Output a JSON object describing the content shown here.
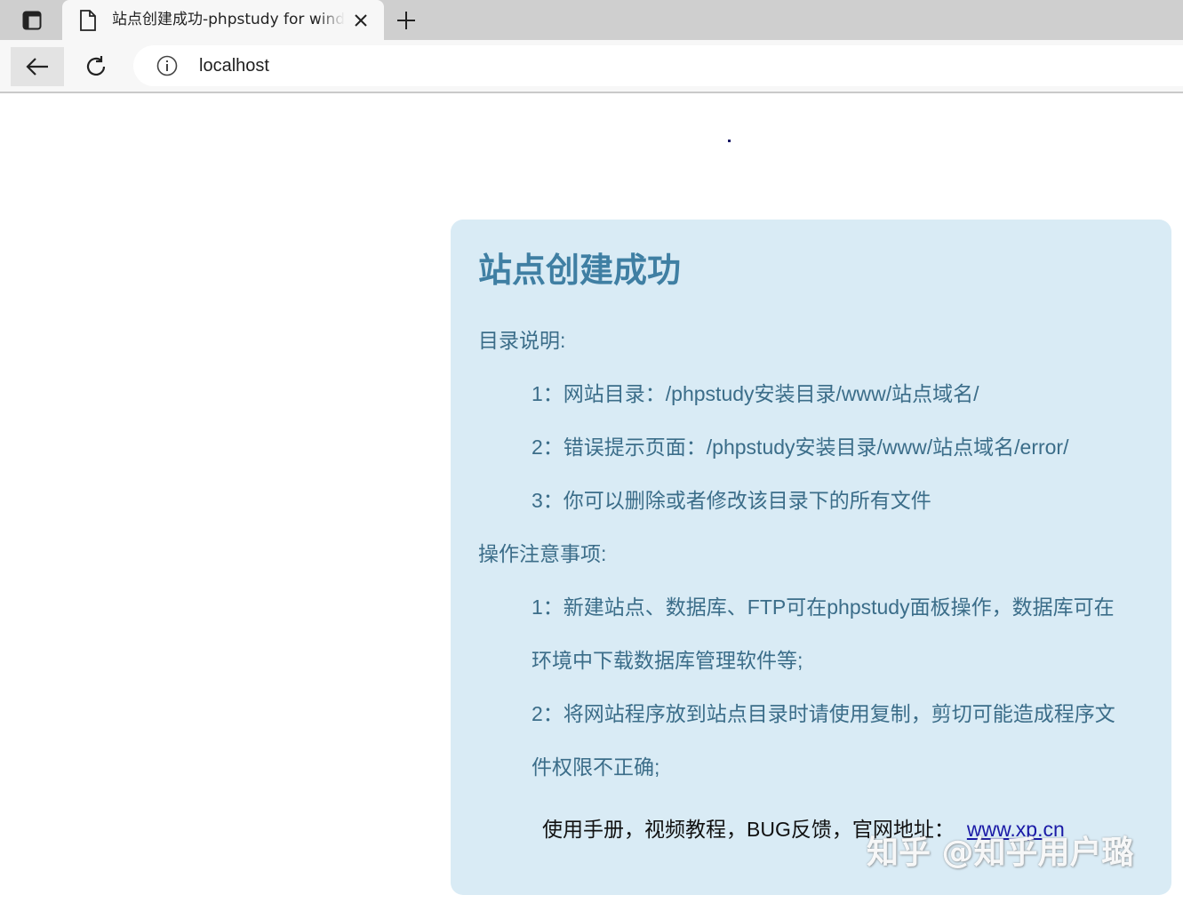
{
  "browser": {
    "tab": {
      "title": "站点创建成功-phpstudy for windows"
    },
    "address_bar": {
      "url": "localhost"
    },
    "icons": {
      "tab_actions": "tab-actions-icon",
      "favicon": "page-icon",
      "close": "close-icon",
      "new_tab": "plus-icon",
      "back": "arrow-left-icon",
      "reload": "reload-icon",
      "site_info": "info-icon"
    }
  },
  "page": {
    "title": "站点创建成功",
    "directory": {
      "heading": "目录说明:",
      "items": [
        "1：网站目录：/phpstudy安装目录/www/站点域名/",
        "2：错误提示页面：/phpstudy安装目录/www/站点域名/error/",
        "3：你可以删除或者修改该目录下的所有文件"
      ]
    },
    "notes": {
      "heading": "操作注意事项:",
      "items": [
        [
          "1：新建站点、数据库、FTP可在phpstudy面板操作，数据库可在",
          "环境中下载数据库管理软件等;"
        ],
        [
          "2：将网站程序放到站点目录时请使用复制，剪切可能造成程序文",
          "件权限不正确;"
        ]
      ]
    },
    "footer": {
      "text": "使用手册，视频教程，BUG反馈，官网地址：",
      "link_text": "www.xp.cn"
    },
    "watermark": "知乎 @知乎用户璐"
  },
  "colors": {
    "card_bg": "#d9ebf5",
    "title": "#3f7fa3",
    "text": "#3b6d89",
    "link": "#1a1aa6"
  }
}
